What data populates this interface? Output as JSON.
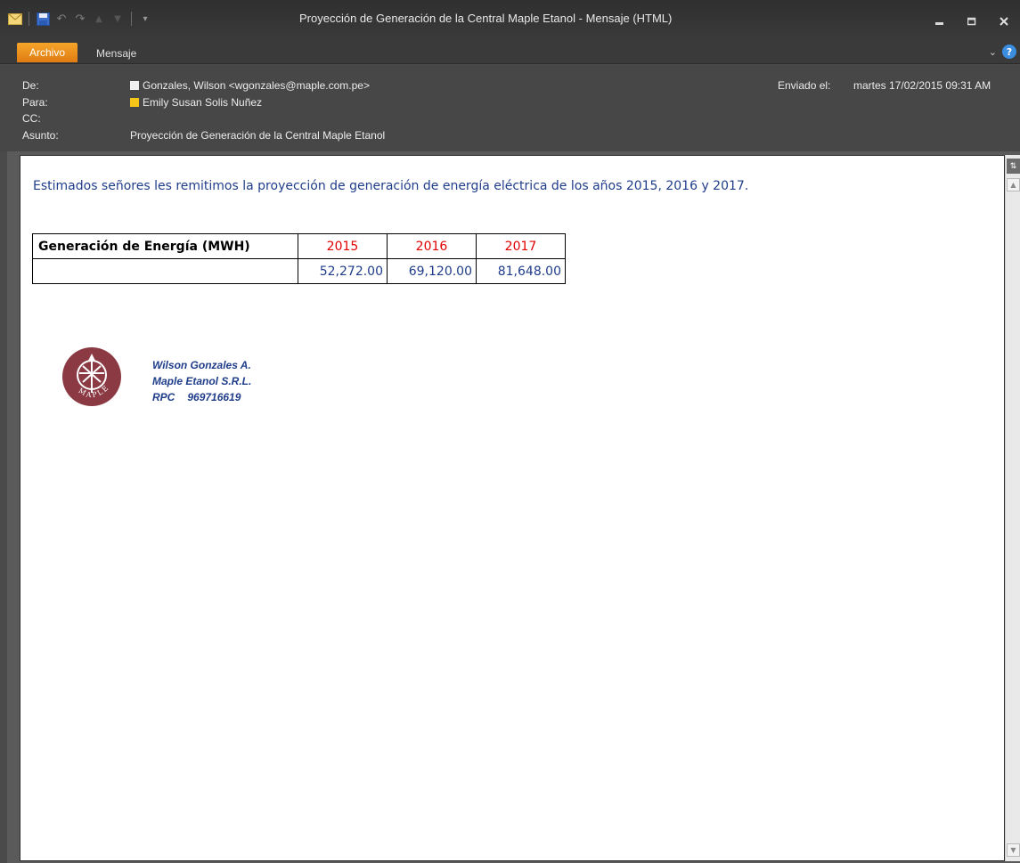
{
  "window": {
    "title": "Proyección de Generación de la Central Maple Etanol  -  Mensaje (HTML)"
  },
  "ribbon": {
    "tabs": [
      "Archivo",
      "Mensaje"
    ]
  },
  "header": {
    "from_label": "De:",
    "from_value": "Gonzales, Wilson <wgonzales@maple.com.pe>",
    "to_label": "Para:",
    "to_value": "Emily Susan Solis Nuñez",
    "cc_label": "CC:",
    "subject_label": "Asunto:",
    "subject_value": "Proyección de Generación de la Central Maple Etanol",
    "sent_label": "Enviado el:",
    "sent_value": "martes 17/02/2015 09:31 AM"
  },
  "body": {
    "intro": "Estimados señores les remitimos la proyección de generación de energía eléctrica de los años 2015, 2016 y 2017.",
    "table": {
      "label": "Generación de Energía  (MWH)",
      "years": [
        "2015",
        "2016",
        "2017"
      ],
      "values": [
        "52,272.00",
        "69,120.00",
        "81,648.00"
      ]
    },
    "signature": {
      "name": "Wilson Gonzales A.",
      "company": "Maple Etanol S.R.L.",
      "rpc_label": "RPC",
      "rpc_number": "969716619",
      "logo_text": "MAPLE"
    }
  },
  "colors": {
    "accent_orange": "#f0921e",
    "body_text_blue": "#1f3d8a",
    "year_red": "#e00000",
    "logo_maroon": "#8b3a44"
  },
  "icons": [
    "envelope-icon",
    "save-icon",
    "undo-icon",
    "redo-icon",
    "up-arrow-icon",
    "down-arrow-icon",
    "customize-icon",
    "minimize-icon",
    "maximize-icon",
    "close-icon",
    "chevron-down-icon",
    "help-icon"
  ]
}
